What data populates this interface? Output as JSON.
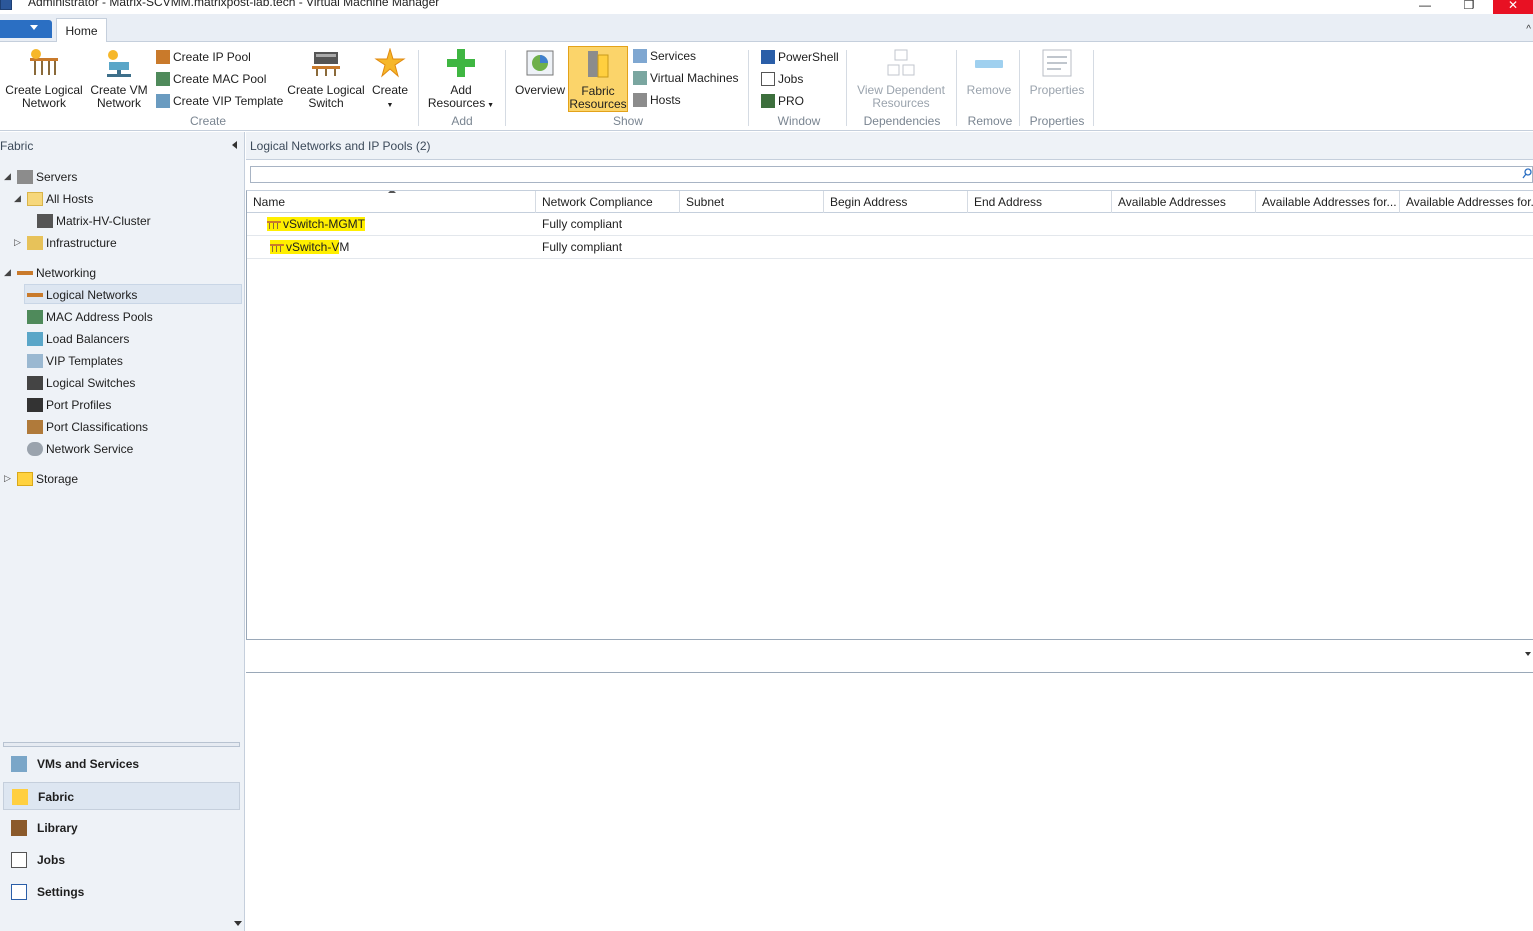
{
  "window": {
    "title": "Administrator - Matrix-SCVMM.matrixpost-lab.tech - Virtual Machine Manager",
    "min_glyph": "—",
    "restore_glyph": "❐",
    "close_glyph": "✕"
  },
  "ribbon": {
    "tabs": [
      {
        "label": "Home"
      }
    ],
    "create_group": {
      "label": "Create",
      "create_logical_network": "Create Logical Network",
      "create_vm_network": "Create VM Network",
      "create_ip_pool": "Create IP Pool",
      "create_mac_pool": "Create MAC Pool",
      "create_vip_template": "Create VIP Template",
      "create_logical_switch": "Create Logical Switch",
      "create": "Create"
    },
    "add_group": {
      "label": "Add",
      "add_resources": "Add Resources"
    },
    "show_group": {
      "label": "Show",
      "overview": "Overview",
      "fabric_resources": "Fabric Resources",
      "services": "Services",
      "virtual_machines": "Virtual Machines",
      "hosts": "Hosts"
    },
    "window_group": {
      "label": "Window",
      "powershell": "PowerShell",
      "jobs": "Jobs",
      "pro": "PRO"
    },
    "dependencies_group": {
      "label": "Dependencies",
      "view_dependent_resources": "View Dependent Resources"
    },
    "remove_group": {
      "label": "Remove",
      "remove": "Remove"
    },
    "properties_group": {
      "label": "Properties",
      "properties": "Properties"
    }
  },
  "nav": {
    "header": "Fabric",
    "servers": "Servers",
    "all_hosts": "All Hosts",
    "cluster": "Matrix-HV-Cluster",
    "infrastructure": "Infrastructure",
    "networking": "Networking",
    "networking_items": [
      {
        "label": "Logical Networks"
      },
      {
        "label": "MAC Address Pools"
      },
      {
        "label": "Load Balancers"
      },
      {
        "label": "VIP Templates"
      },
      {
        "label": "Logical Switches"
      },
      {
        "label": "Port Profiles"
      },
      {
        "label": "Port Classifications"
      },
      {
        "label": "Network Service"
      }
    ],
    "storage": "Storage",
    "workspaces": [
      {
        "label": "VMs and Services"
      },
      {
        "label": "Fabric"
      },
      {
        "label": "Library"
      },
      {
        "label": "Jobs"
      },
      {
        "label": "Settings"
      }
    ]
  },
  "main": {
    "title": "Logical Networks and IP Pools (2)",
    "search_value": "",
    "columns": [
      {
        "label": "Name"
      },
      {
        "label": "Network Compliance"
      },
      {
        "label": "Subnet"
      },
      {
        "label": "Begin Address"
      },
      {
        "label": "End Address"
      },
      {
        "label": "Available Addresses"
      },
      {
        "label": "Available Addresses for..."
      },
      {
        "label": "Available Addresses for..."
      }
    ],
    "rows": [
      {
        "name_highlighted": "vSwitch-MGMT",
        "name_rest": "",
        "compliance": "Fully compliant"
      },
      {
        "name_highlighted": "vSwitch-V",
        "name_rest": "M",
        "compliance": "Fully compliant"
      }
    ]
  },
  "colors": {
    "accent": "#2b6fc3",
    "highlight": "#ffef00",
    "active_button": "#fbd46a",
    "close_red": "#e81123"
  }
}
